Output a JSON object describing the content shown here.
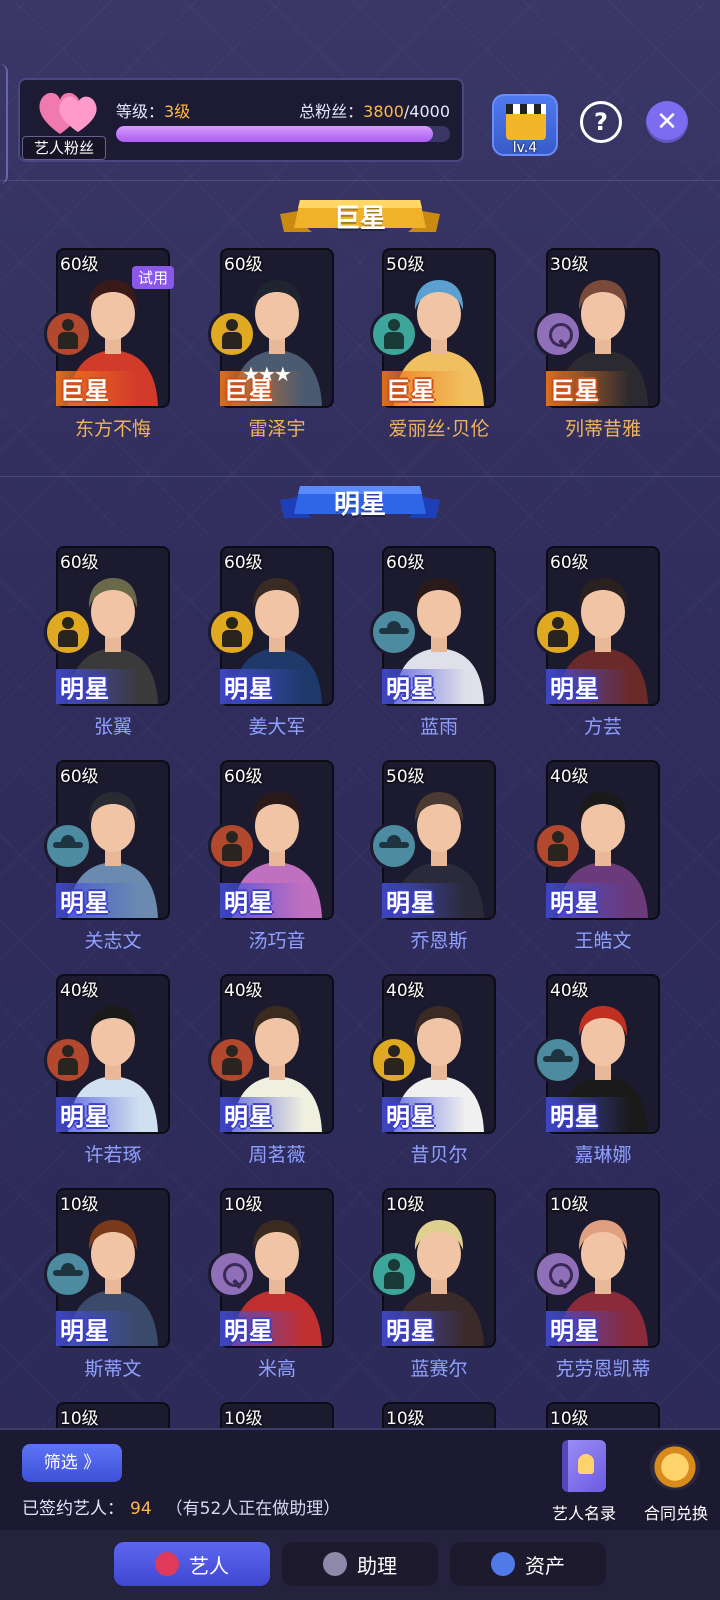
{
  "header": {
    "fan_label": "艺人粉丝",
    "level_prefix": "等级：",
    "level_value": "3级",
    "fans_prefix": "总粉丝：",
    "fans_current": "3800",
    "fans_sep_total": "/4000",
    "fans_progress": 0.95,
    "clapboard_level": "lv.4",
    "help_symbol": "?",
    "close_symbol": "✕"
  },
  "sections": {
    "superstar_title": "巨星",
    "star_title": "明星"
  },
  "superstars": [
    {
      "level": "60级",
      "rank": "巨星",
      "name": "东方不悔",
      "badge": "rust",
      "trial": "试用"
    },
    {
      "level": "60级",
      "rank": "巨星",
      "name": "雷泽宇",
      "badge": "gold",
      "stars": "★★★"
    },
    {
      "level": "50级",
      "rank": "巨星",
      "name": "爱丽丝·贝伦",
      "badge": "aqua"
    },
    {
      "level": "30级",
      "rank": "巨星",
      "name": "列蒂昔雅",
      "badge": "purple"
    }
  ],
  "stars": [
    {
      "level": "60级",
      "rank": "明星",
      "name": "张翼",
      "badge": "gold"
    },
    {
      "level": "60级",
      "rank": "明星",
      "name": "姜大军",
      "badge": "gold"
    },
    {
      "level": "60级",
      "rank": "明星",
      "name": "蓝雨",
      "badge": "teal ufo"
    },
    {
      "level": "60级",
      "rank": "明星",
      "name": "方芸",
      "badge": "gold"
    },
    {
      "level": "60级",
      "rank": "明星",
      "name": "关志文",
      "badge": "teal ufo"
    },
    {
      "level": "60级",
      "rank": "明星",
      "name": "汤巧音",
      "badge": "rust"
    },
    {
      "level": "50级",
      "rank": "明星",
      "name": "乔恩斯",
      "badge": "teal ufo"
    },
    {
      "level": "40级",
      "rank": "明星",
      "name": "王皓文",
      "badge": "rust"
    },
    {
      "level": "40级",
      "rank": "明星",
      "name": "许若琢",
      "badge": "rust"
    },
    {
      "level": "40级",
      "rank": "明星",
      "name": "周茗薇",
      "badge": "rust"
    },
    {
      "level": "40级",
      "rank": "明星",
      "name": "昔贝尔",
      "badge": "gold"
    },
    {
      "level": "40级",
      "rank": "明星",
      "name": "嘉琳娜",
      "badge": "teal ufo"
    },
    {
      "level": "10级",
      "rank": "明星",
      "name": "斯蒂文",
      "badge": "teal ufo"
    },
    {
      "level": "10级",
      "rank": "明星",
      "name": "米高",
      "badge": "purple"
    },
    {
      "level": "10级",
      "rank": "明星",
      "name": "蓝赛尔",
      "badge": "aqua"
    },
    {
      "level": "10级",
      "rank": "明星",
      "name": "克劳恩凯蒂",
      "badge": "purple"
    }
  ],
  "partial_row_levels": [
    "10级",
    "10级",
    "10级",
    "10级"
  ],
  "bottom": {
    "filter_label": "筛选 》",
    "signed_label": "已签约艺人：",
    "signed_count": "94",
    "signed_note": "（有52人正在做助理）",
    "roster_label": "艺人名录",
    "contract_label": "合同兑换"
  },
  "tabs": [
    {
      "label": "艺人",
      "active": true
    },
    {
      "label": "助理",
      "active": false
    },
    {
      "label": "资产",
      "active": false
    }
  ],
  "colors": {
    "accent_gold": "#ffb84a",
    "superstar_name": "#f0b35a",
    "star_name": "#8fa0ff",
    "progress_fill": "#b56cf2"
  }
}
